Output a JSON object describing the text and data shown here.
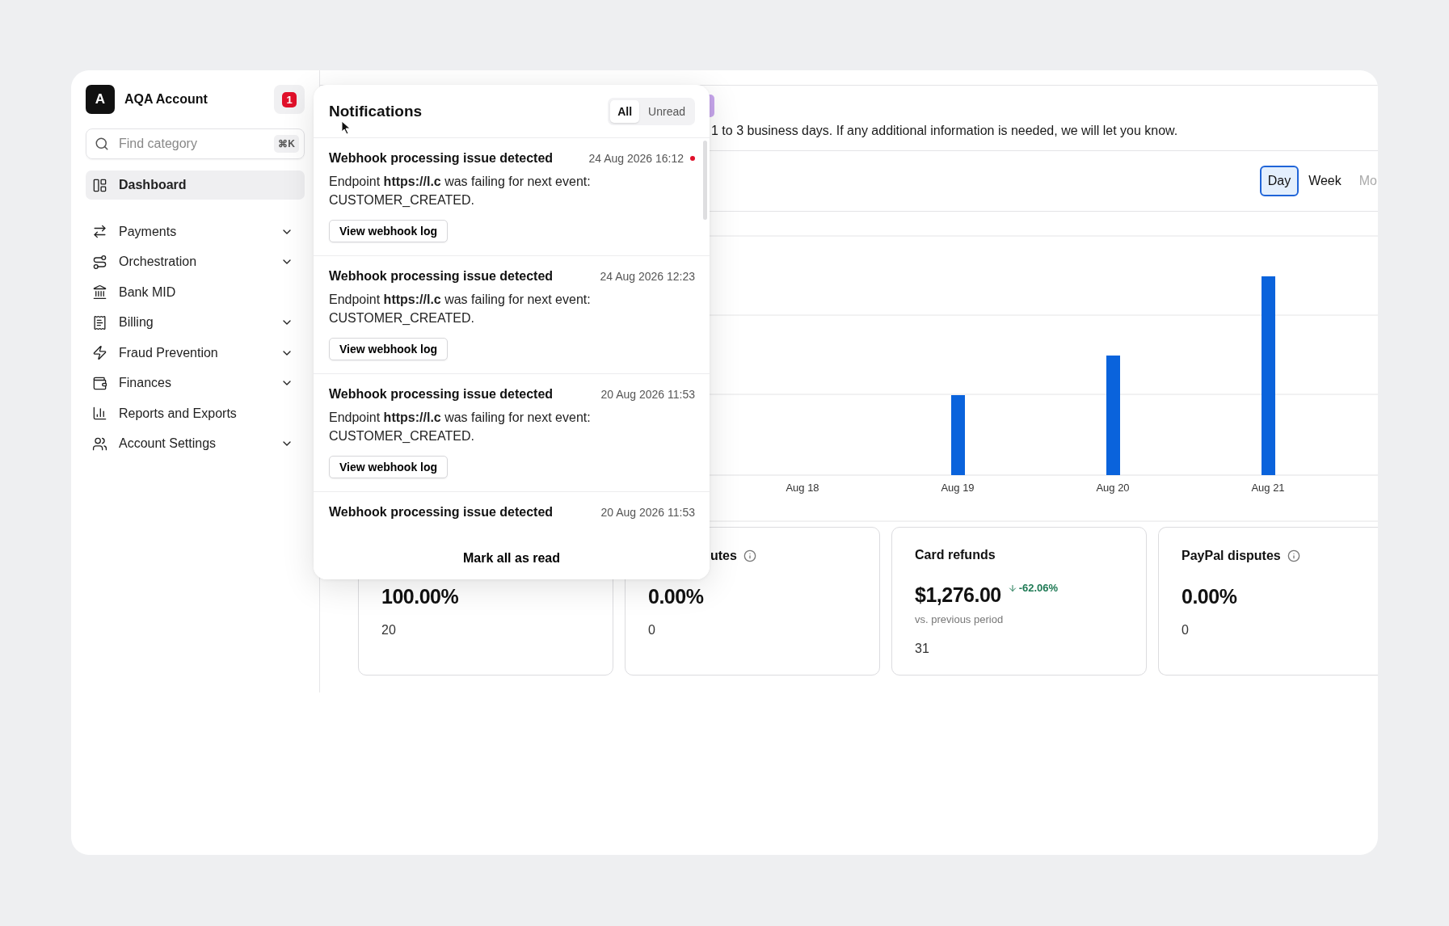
{
  "account": {
    "initial": "A",
    "name": "AQA Account",
    "notification_count": "1"
  },
  "search": {
    "placeholder": "Find category",
    "shortcut": "⌘K"
  },
  "sidebar": {
    "items": [
      {
        "label": "Dashboard",
        "selected": true,
        "expandable": false
      },
      {
        "label": "Payments",
        "selected": false,
        "expandable": true
      },
      {
        "label": "Orchestration",
        "selected": false,
        "expandable": true
      },
      {
        "label": "Bank MID",
        "selected": false,
        "expandable": false
      },
      {
        "label": "Billing",
        "selected": false,
        "expandable": true
      },
      {
        "label": "Fraud Prevention",
        "selected": false,
        "expandable": true
      },
      {
        "label": "Finances",
        "selected": false,
        "expandable": true
      },
      {
        "label": "Reports and Exports",
        "selected": false,
        "expandable": false
      },
      {
        "label": "Account Settings",
        "selected": false,
        "expandable": true
      }
    ]
  },
  "banner": {
    "text": "1 to 3 business days. If any additional information is needed, we will let you know."
  },
  "period_tabs": [
    {
      "label": "Day",
      "selected": true
    },
    {
      "label": "Week",
      "selected": false
    },
    {
      "label": "Mo",
      "selected": false
    }
  ],
  "chart": {
    "x_labels": [
      "Aug 18",
      "Aug 19",
      "Aug 20",
      "Aug 21"
    ]
  },
  "cards": [
    {
      "value": "100.00%",
      "count": "20"
    },
    {
      "title": "utes",
      "info": true,
      "value": "0.00%",
      "count": "0"
    },
    {
      "title": "Card refunds",
      "info": false,
      "value": "$1,276.00",
      "delta": {
        "text": "-62.06%",
        "down": true
      },
      "note": "vs. previous period",
      "count": "31"
    },
    {
      "title": "PayPal disputes",
      "info": true,
      "value": "0.00%",
      "count": "0"
    }
  ],
  "notifications": {
    "title": "Notifications",
    "filters": [
      {
        "label": "All",
        "selected": true
      },
      {
        "label": "Unread",
        "selected": false
      }
    ],
    "items": [
      {
        "title": "Webhook processing issue detected",
        "date": "24 Aug 2026 16:12",
        "unread": true,
        "body": "Endpoint **https://l.c** was failing for next event: CUSTOMER_CREATED.",
        "action": "View webhook log"
      },
      {
        "title": "Webhook processing issue detected",
        "date": "24 Aug 2026 12:23",
        "unread": false,
        "body": "Endpoint **https://l.c** was failing for next event: CUSTOMER_CREATED.",
        "action": "View webhook log"
      },
      {
        "title": "Webhook processing issue detected",
        "date": "20 Aug 2026 11:53",
        "unread": false,
        "body": "Endpoint **https://l.c** was failing for next event: CUSTOMER_CREATED.",
        "action": "View webhook log"
      },
      {
        "title": "Webhook processing issue detected",
        "date": "20 Aug 2026 11:53",
        "unread": false
      }
    ],
    "footer": "Mark all as read"
  }
}
